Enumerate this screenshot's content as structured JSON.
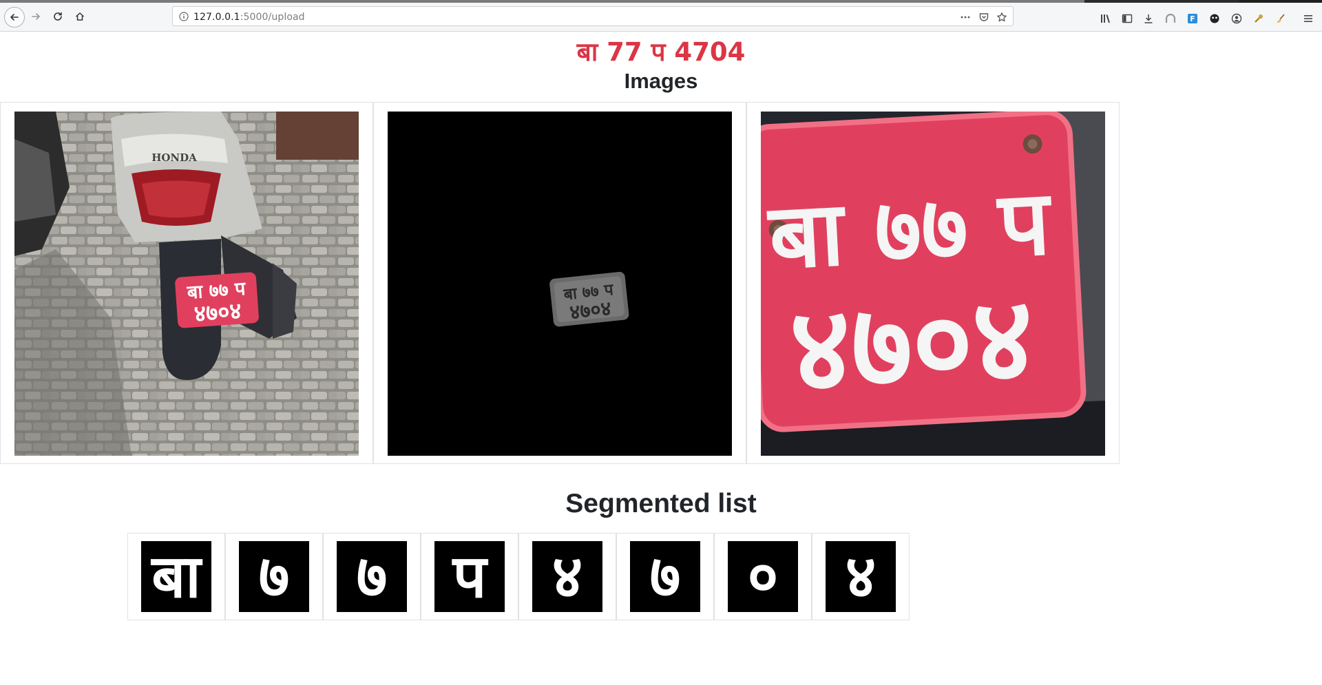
{
  "browser": {
    "url_host": "127.0.0.1",
    "url_path": ":5000/upload"
  },
  "page": {
    "plate_text": "बा 77 प 4704",
    "images_heading": "Images",
    "segmented_heading": "Segmented list"
  },
  "images": [
    {
      "name": "original-photo",
      "plate_line1": "बा ७७ प",
      "plate_line2": "४७०४",
      "brand": "HONDA"
    },
    {
      "name": "masked-plate",
      "plate_line1": "बा ७७ प",
      "plate_line2": "४७०४"
    },
    {
      "name": "cropped-plate",
      "plate_line1": "बा ७७ प",
      "plate_line2": "४७०४"
    }
  ],
  "segments": [
    "बा",
    "७",
    "७",
    "प",
    "४",
    "७",
    "०",
    "४"
  ],
  "colors": {
    "result_text": "#dc3545",
    "plate_red": "#e0405e",
    "heading_text": "#212529"
  }
}
